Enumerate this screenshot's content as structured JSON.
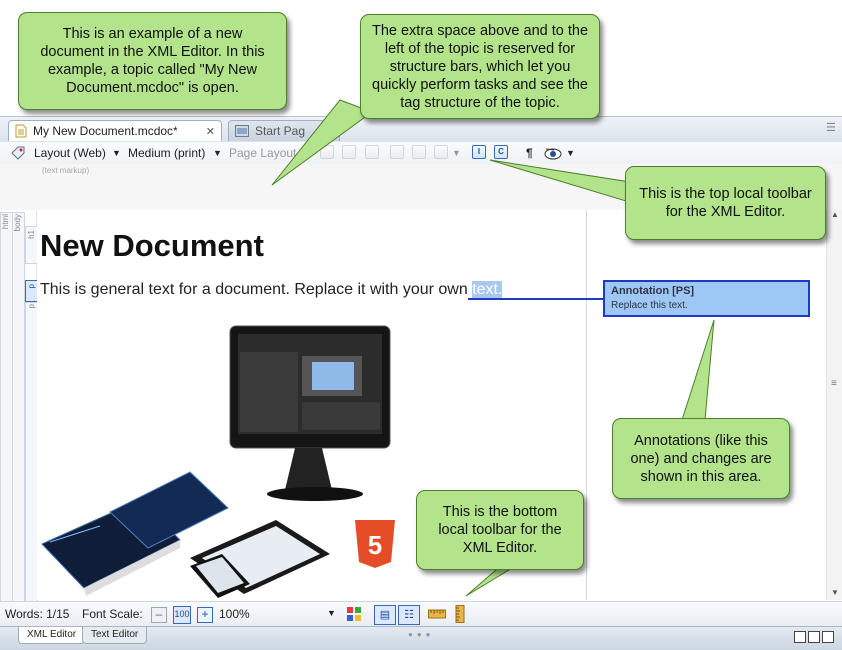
{
  "tabs": [
    {
      "label": "My New Document.mcdoc*",
      "active": true
    },
    {
      "label": "Start Pag",
      "active": false
    }
  ],
  "toolbar": {
    "layout": "Layout (Web)",
    "medium": "Medium (print)",
    "page_layout": "Page Layout"
  },
  "markup_label": "(text markup)",
  "structure_bars": [
    "html",
    "body",
    "h1",
    "p",
    "p"
  ],
  "document": {
    "title": "New Document",
    "paragraph_text": "This is general text for a document. Replace it with your own ",
    "paragraph_highlight": "text."
  },
  "annotation": {
    "title": "Annotation [PS]",
    "text": "Replace this text."
  },
  "bottom_toolbar": {
    "words": "Words: 1/15",
    "font_scale_label": "Font Scale:",
    "zoom": "100%"
  },
  "bottom_tabs": [
    {
      "label": "XML Editor",
      "active": true
    },
    {
      "label": "Text Editor",
      "active": false
    }
  ],
  "callouts": {
    "new_doc": "This is an example of a new document in the XML Editor. In this example, a topic called \"My New Document.mcdoc\" is open.",
    "structure": "The extra space above and to the left of the topic is reserved for structure bars, which let you quickly perform tasks and see the tag structure of the topic.",
    "top_toolbar": "This is the top local toolbar for the XML Editor.",
    "annotations": "Annotations (like this one) and changes are shown in this area.",
    "bottom_toolbar": "This is the bottom local toolbar for the XML Editor."
  },
  "colors": {
    "callout_fill": "#b3e38a",
    "annotation_fill": "#9dc8f5",
    "annotation_border": "#2038c8",
    "selection_highlight": "#a8c8ee"
  }
}
